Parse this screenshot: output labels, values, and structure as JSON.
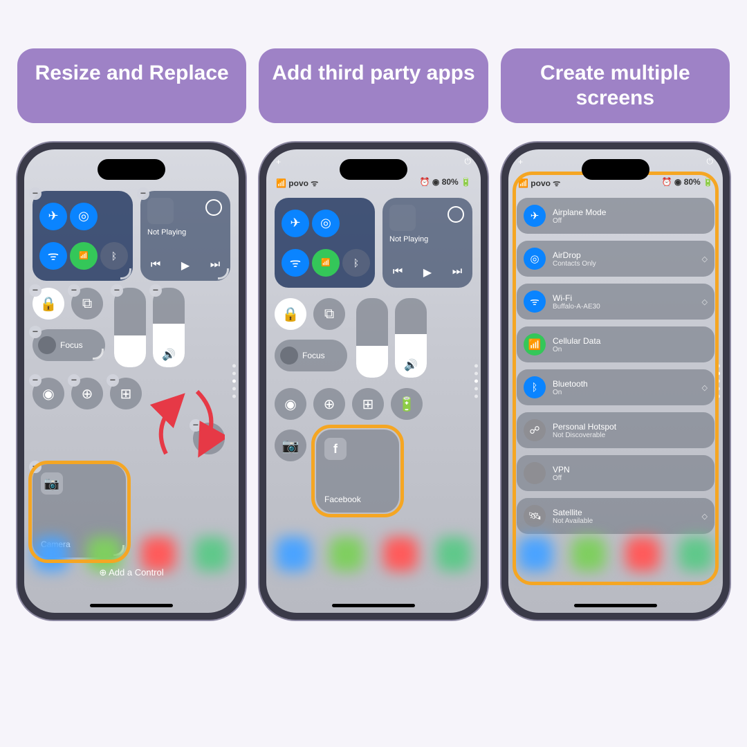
{
  "labels": [
    "Resize and Replace",
    "Add third party apps",
    "Create multiple screens"
  ],
  "status": {
    "carrier": "povo",
    "battery": "80%"
  },
  "media": {
    "title": "Not Playing"
  },
  "focus": "Focus",
  "phone1": {
    "camera": "Camera",
    "addControl": "Add a Control"
  },
  "phone2": {
    "facebook": "Facebook"
  },
  "phone3": {
    "rows": [
      {
        "title": "Airplane Mode",
        "sub": "Off",
        "color": "#0a84ff",
        "icon": "✈"
      },
      {
        "title": "AirDrop",
        "sub": "Contacts Only",
        "color": "#0a84ff",
        "icon": "◎",
        "chev": true
      },
      {
        "title": "Wi-Fi",
        "sub": "Buffalo-A-AE30",
        "color": "#0a84ff",
        "icon": "ᯤ",
        "chev": true
      },
      {
        "title": "Cellular Data",
        "sub": "On",
        "color": "#34c759",
        "icon": "📶"
      },
      {
        "title": "Bluetooth",
        "sub": "On",
        "color": "#0a84ff",
        "icon": "ᛒ",
        "chev": true
      },
      {
        "title": "Personal Hotspot",
        "sub": "Not Discoverable",
        "color": "#8e8e93",
        "icon": "☍"
      },
      {
        "title": "VPN",
        "sub": "Off",
        "color": "#8e8e93",
        "icon": ""
      },
      {
        "title": "Satellite",
        "sub": "Not Available",
        "color": "#8e8e93",
        "icon": "🛰",
        "chev": true
      }
    ]
  }
}
